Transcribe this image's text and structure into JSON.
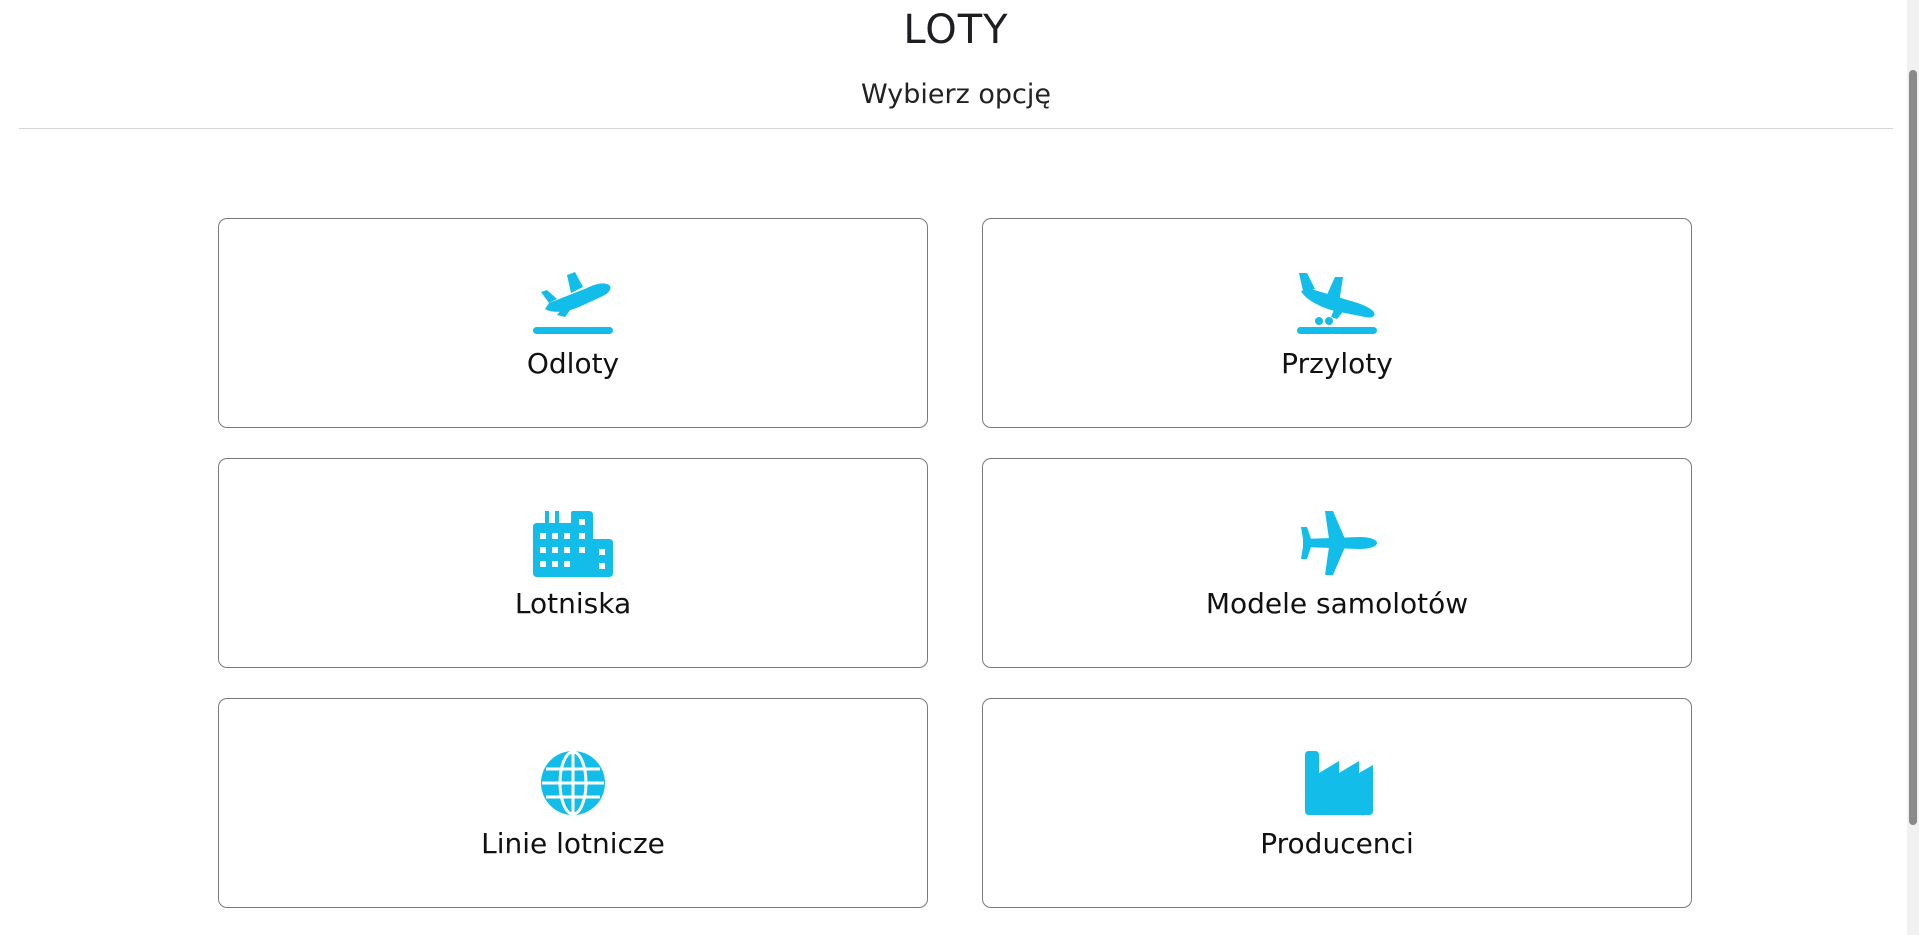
{
  "header": {
    "title": "LOTY",
    "subtitle": "Wybierz opcję"
  },
  "theme": {
    "accent": "#13bde9",
    "border": "#7a7a7a",
    "divider": "#d4d4d4"
  },
  "options": [
    {
      "label": "Odloty",
      "icon": "plane-departure-icon"
    },
    {
      "label": "Przyloty",
      "icon": "plane-arrival-icon"
    },
    {
      "label": "Lotniska",
      "icon": "city-buildings-icon"
    },
    {
      "label": "Modele samolotów",
      "icon": "plane-icon"
    },
    {
      "label": "Linie lotnicze",
      "icon": "globe-icon"
    },
    {
      "label": "Producenci",
      "icon": "factory-icon"
    }
  ]
}
